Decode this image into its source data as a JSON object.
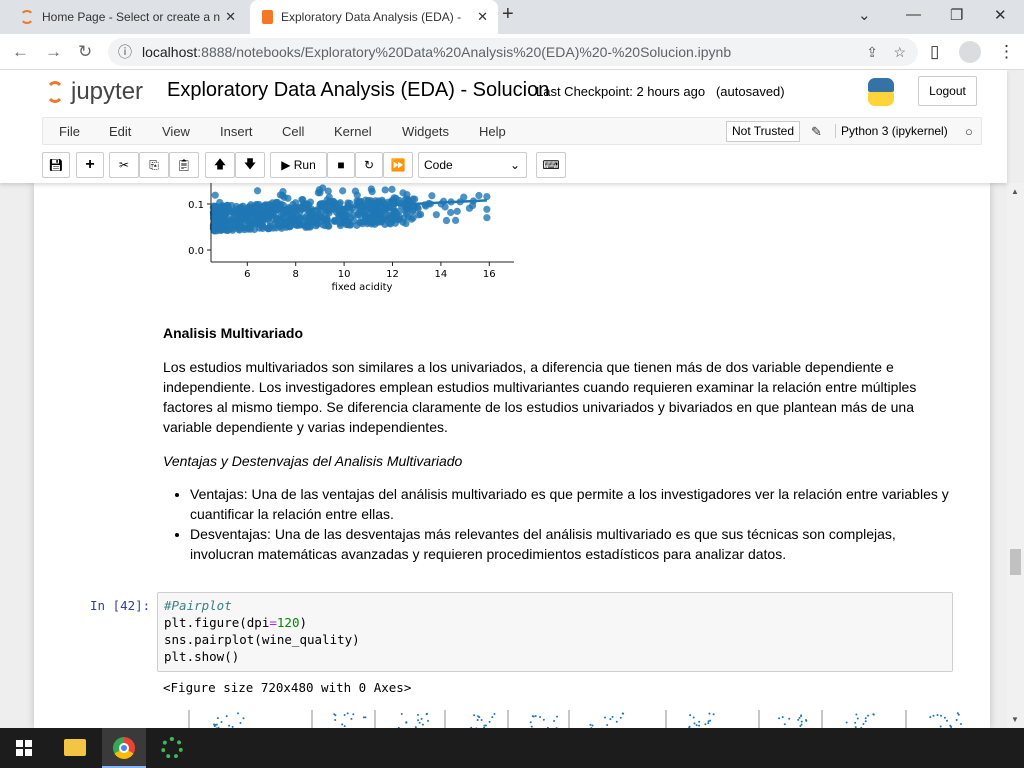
{
  "browser": {
    "tabs": [
      {
        "label": "Home Page - Select or create a n"
      },
      {
        "label": "Exploratory Data Analysis (EDA) -"
      }
    ],
    "url_host": "localhost",
    "url_path": ":8888/notebooks/Exploratory%20Data%20Analysis%20(EDA)%20-%20Solucion.ipynb"
  },
  "jupyter": {
    "logo": "jupyter",
    "title": "Exploratory Data Analysis (EDA) - Solucion",
    "checkpoint": "Last Checkpoint: 2 hours ago",
    "autosaved": "(autosaved)",
    "logout": "Logout",
    "menu": [
      "File",
      "Edit",
      "View",
      "Insert",
      "Cell",
      "Kernel",
      "Widgets",
      "Help"
    ],
    "trust": "Not Trusted",
    "kernel": "Python 3 (ipykernel)",
    "run": "Run",
    "cell_type": "Code"
  },
  "plot": {
    "xlabel": "fixed acidity",
    "xticks": [
      "6",
      "8",
      "10",
      "12",
      "14",
      "16"
    ],
    "yticks": [
      "0.0",
      "0.1"
    ],
    "color": "#1f77b4"
  },
  "markdown": {
    "heading": "Analisis Multivariado",
    "para": "Los estudios multivariados son similares a los univariados, a diferencia que tienen más de dos variable dependiente e independiente. Los investigadores emplean estudios multivariantes cuando requieren examinar la relación entre múltiples factores al mismo tiempo. Se diferencia claramente de los estudios univariados y bivariados en que plantean más de una variable dependiente y varias independientes.",
    "subheading": "Ventajas y Destenvajas del Analisis Multivariado",
    "bullets": [
      "Ventajas: Una de las ventajas del análisis multivariado es que permite a los investigadores ver la relación entre variables y cuantificar la relación entre ellas.",
      "Desventajas: Una de las desventajas más relevantes del análisis multivariado es que sus técnicas son complejas, involucran matemáticas avanzadas y requieren procedimientos estadísticos para analizar datos."
    ]
  },
  "cell": {
    "prompt": "In [42]:",
    "comment": "#Pairplot",
    "l2a": "plt.figure(dpi",
    "l2op": "=",
    "l2n": "120",
    "l2b": ")",
    "l3": "sns.pairplot(wine_quality)",
    "l4": "plt.show()",
    "output": "<Figure size 720x480 with 0 Axes>"
  }
}
